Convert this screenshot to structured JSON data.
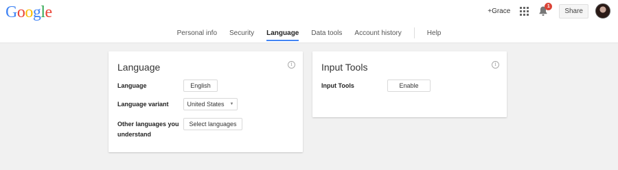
{
  "header": {
    "logo_letters": [
      "G",
      "o",
      "o",
      "g",
      "l",
      "e"
    ],
    "logo_colors": [
      "#4285f4",
      "#ea4335",
      "#fbbc05",
      "#4285f4",
      "#34a853",
      "#ea4335"
    ],
    "plus_name": "+Grace",
    "notification_count": "1",
    "share_label": "Share"
  },
  "nav": {
    "items": [
      "Personal info",
      "Security",
      "Language",
      "Data tools",
      "Account history",
      "Help"
    ],
    "active": "Language"
  },
  "language_card": {
    "title": "Language",
    "rows": [
      {
        "label": "Language",
        "value": "English"
      },
      {
        "label": "Language variant",
        "value": "United States"
      },
      {
        "label_line1": "Other languages you",
        "label_line2": "understand",
        "value": "Select languages"
      }
    ]
  },
  "input_tools_card": {
    "title": "Input Tools",
    "row_label": "Input Tools",
    "button_label": "Enable"
  },
  "colors": {
    "accent": "#4285f4",
    "badge": "#db4437",
    "background": "#f1f1f1"
  }
}
